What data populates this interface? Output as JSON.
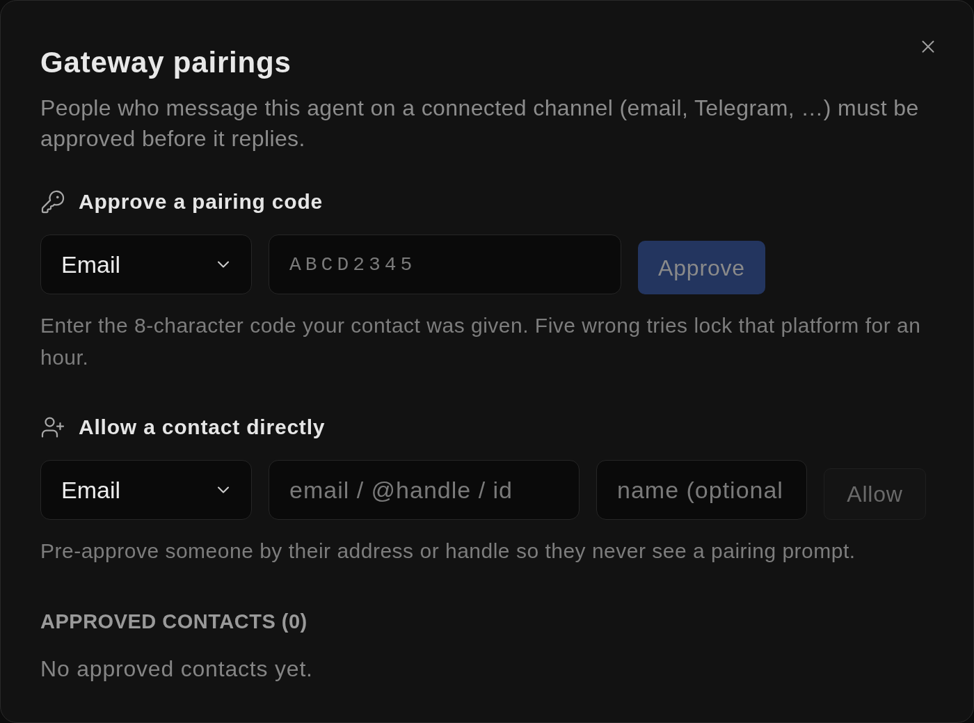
{
  "dialog": {
    "title": "Gateway pairings",
    "description": "People who message this agent on a connected channel (email, Telegram, …) must be approved before it replies."
  },
  "sections": [
    {
      "kind": "pairing_code",
      "heading": "Approve a pairing code",
      "channel_select": {
        "value": "Email"
      },
      "fields": [
        {
          "kind": "code",
          "placeholder": "ABCD2345"
        }
      ],
      "button": {
        "label": "Approve",
        "disabled": true
      },
      "help": "Enter the 8-character code your contact was given. Five wrong tries lock that platform for an hour."
    },
    {
      "kind": "direct_contact",
      "heading": "Allow a contact directly",
      "channel_select": {
        "value": "Email"
      },
      "fields": [
        {
          "kind": "text",
          "placeholder": "email / @handle / id"
        },
        {
          "kind": "text",
          "placeholder": "name (optional"
        }
      ],
      "button": {
        "label": "Allow",
        "disabled": true
      },
      "help": "Pre-approve someone by their address or handle so they never see a pairing prompt."
    }
  ],
  "approved_contacts": {
    "heading": "APPROVED CONTACTS (0)",
    "empty_text": "No approved contacts yet."
  }
}
